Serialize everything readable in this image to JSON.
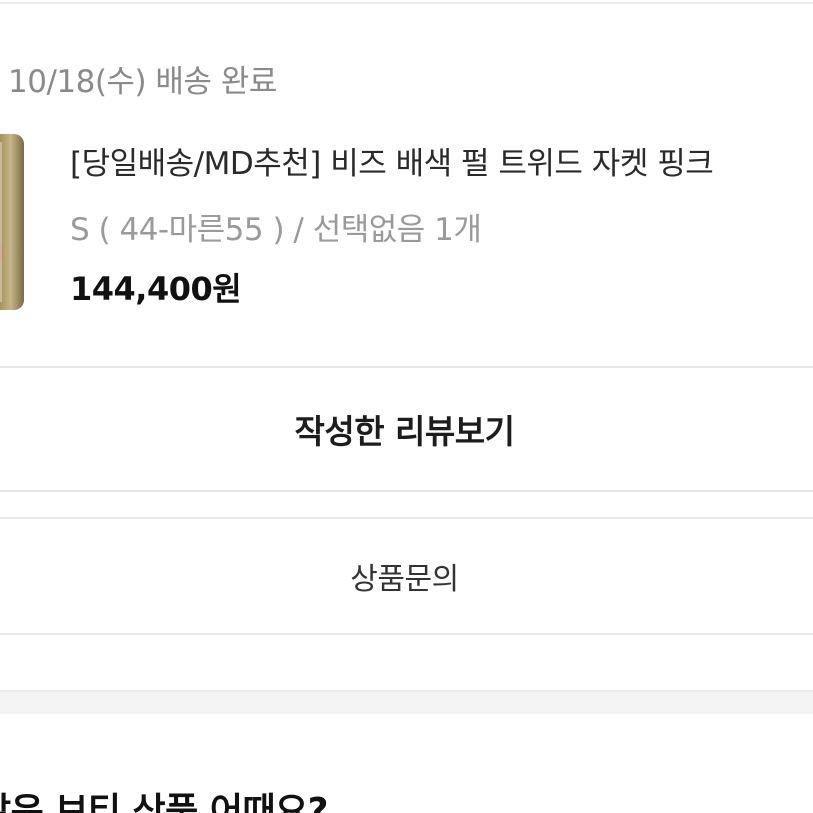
{
  "order": {
    "status": "10/18(수) 배송 완료"
  },
  "product": {
    "title": "[당일배송/MD추천] 비즈 배색 펄 트위드 자켓 핑크",
    "option": "S ( 44-마른55 ) / 선택없음 1개",
    "price": "144,400원"
  },
  "actions": {
    "review_label": "작성한 리뷰보기",
    "inquiry_label": "상품문의"
  },
  "recommend": {
    "title": "같은 브티 상품 어때요?"
  }
}
